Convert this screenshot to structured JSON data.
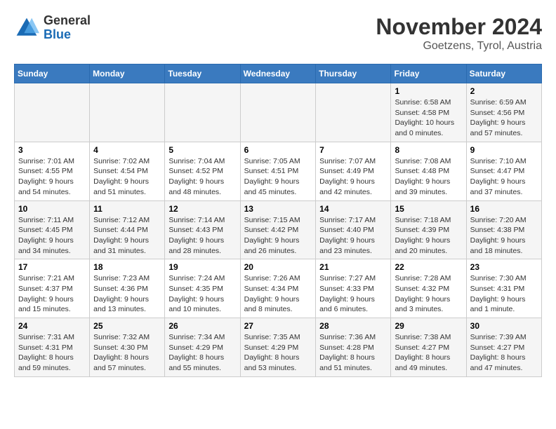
{
  "logo": {
    "line1": "General",
    "line2": "Blue"
  },
  "title": "November 2024",
  "subtitle": "Goetzens, Tyrol, Austria",
  "weekdays": [
    "Sunday",
    "Monday",
    "Tuesday",
    "Wednesday",
    "Thursday",
    "Friday",
    "Saturday"
  ],
  "weeks": [
    [
      {
        "day": "",
        "info": ""
      },
      {
        "day": "",
        "info": ""
      },
      {
        "day": "",
        "info": ""
      },
      {
        "day": "",
        "info": ""
      },
      {
        "day": "",
        "info": ""
      },
      {
        "day": "1",
        "info": "Sunrise: 6:58 AM\nSunset: 4:58 PM\nDaylight: 10 hours\nand 0 minutes."
      },
      {
        "day": "2",
        "info": "Sunrise: 6:59 AM\nSunset: 4:56 PM\nDaylight: 9 hours\nand 57 minutes."
      }
    ],
    [
      {
        "day": "3",
        "info": "Sunrise: 7:01 AM\nSunset: 4:55 PM\nDaylight: 9 hours\nand 54 minutes."
      },
      {
        "day": "4",
        "info": "Sunrise: 7:02 AM\nSunset: 4:54 PM\nDaylight: 9 hours\nand 51 minutes."
      },
      {
        "day": "5",
        "info": "Sunrise: 7:04 AM\nSunset: 4:52 PM\nDaylight: 9 hours\nand 48 minutes."
      },
      {
        "day": "6",
        "info": "Sunrise: 7:05 AM\nSunset: 4:51 PM\nDaylight: 9 hours\nand 45 minutes."
      },
      {
        "day": "7",
        "info": "Sunrise: 7:07 AM\nSunset: 4:49 PM\nDaylight: 9 hours\nand 42 minutes."
      },
      {
        "day": "8",
        "info": "Sunrise: 7:08 AM\nSunset: 4:48 PM\nDaylight: 9 hours\nand 39 minutes."
      },
      {
        "day": "9",
        "info": "Sunrise: 7:10 AM\nSunset: 4:47 PM\nDaylight: 9 hours\nand 37 minutes."
      }
    ],
    [
      {
        "day": "10",
        "info": "Sunrise: 7:11 AM\nSunset: 4:45 PM\nDaylight: 9 hours\nand 34 minutes."
      },
      {
        "day": "11",
        "info": "Sunrise: 7:12 AM\nSunset: 4:44 PM\nDaylight: 9 hours\nand 31 minutes."
      },
      {
        "day": "12",
        "info": "Sunrise: 7:14 AM\nSunset: 4:43 PM\nDaylight: 9 hours\nand 28 minutes."
      },
      {
        "day": "13",
        "info": "Sunrise: 7:15 AM\nSunset: 4:42 PM\nDaylight: 9 hours\nand 26 minutes."
      },
      {
        "day": "14",
        "info": "Sunrise: 7:17 AM\nSunset: 4:40 PM\nDaylight: 9 hours\nand 23 minutes."
      },
      {
        "day": "15",
        "info": "Sunrise: 7:18 AM\nSunset: 4:39 PM\nDaylight: 9 hours\nand 20 minutes."
      },
      {
        "day": "16",
        "info": "Sunrise: 7:20 AM\nSunset: 4:38 PM\nDaylight: 9 hours\nand 18 minutes."
      }
    ],
    [
      {
        "day": "17",
        "info": "Sunrise: 7:21 AM\nSunset: 4:37 PM\nDaylight: 9 hours\nand 15 minutes."
      },
      {
        "day": "18",
        "info": "Sunrise: 7:23 AM\nSunset: 4:36 PM\nDaylight: 9 hours\nand 13 minutes."
      },
      {
        "day": "19",
        "info": "Sunrise: 7:24 AM\nSunset: 4:35 PM\nDaylight: 9 hours\nand 10 minutes."
      },
      {
        "day": "20",
        "info": "Sunrise: 7:26 AM\nSunset: 4:34 PM\nDaylight: 9 hours\nand 8 minutes."
      },
      {
        "day": "21",
        "info": "Sunrise: 7:27 AM\nSunset: 4:33 PM\nDaylight: 9 hours\nand 6 minutes."
      },
      {
        "day": "22",
        "info": "Sunrise: 7:28 AM\nSunset: 4:32 PM\nDaylight: 9 hours\nand 3 minutes."
      },
      {
        "day": "23",
        "info": "Sunrise: 7:30 AM\nSunset: 4:31 PM\nDaylight: 9 hours\nand 1 minute."
      }
    ],
    [
      {
        "day": "24",
        "info": "Sunrise: 7:31 AM\nSunset: 4:31 PM\nDaylight: 8 hours\nand 59 minutes."
      },
      {
        "day": "25",
        "info": "Sunrise: 7:32 AM\nSunset: 4:30 PM\nDaylight: 8 hours\nand 57 minutes."
      },
      {
        "day": "26",
        "info": "Sunrise: 7:34 AM\nSunset: 4:29 PM\nDaylight: 8 hours\nand 55 minutes."
      },
      {
        "day": "27",
        "info": "Sunrise: 7:35 AM\nSunset: 4:29 PM\nDaylight: 8 hours\nand 53 minutes."
      },
      {
        "day": "28",
        "info": "Sunrise: 7:36 AM\nSunset: 4:28 PM\nDaylight: 8 hours\nand 51 minutes."
      },
      {
        "day": "29",
        "info": "Sunrise: 7:38 AM\nSunset: 4:27 PM\nDaylight: 8 hours\nand 49 minutes."
      },
      {
        "day": "30",
        "info": "Sunrise: 7:39 AM\nSunset: 4:27 PM\nDaylight: 8 hours\nand 47 minutes."
      }
    ]
  ]
}
